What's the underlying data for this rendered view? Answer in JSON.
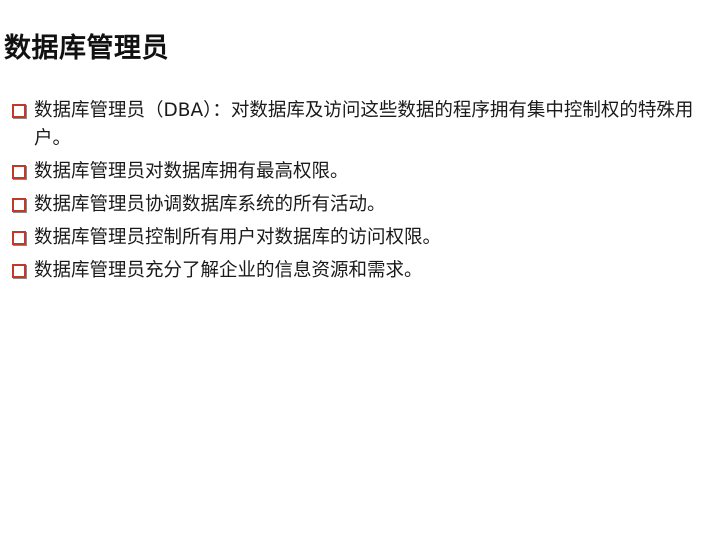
{
  "slide": {
    "title": "数据库管理员",
    "bullets": [
      "数据库管理员（DBA）：对数据库及访问这些数据的程序拥有集中控制权的特殊用户。",
      "数据库管理员对数据库拥有最高权限。",
      "数据库管理员协调数据库系统的所有活动。",
      "数据库管理员控制所有用户对数据库的访问权限。",
      "数据库管理员充分了解企业的信息资源和需求。"
    ]
  },
  "colors": {
    "bullet_marker": "#c0392b",
    "text": "#1a1a1a",
    "background": "#ffffff"
  }
}
